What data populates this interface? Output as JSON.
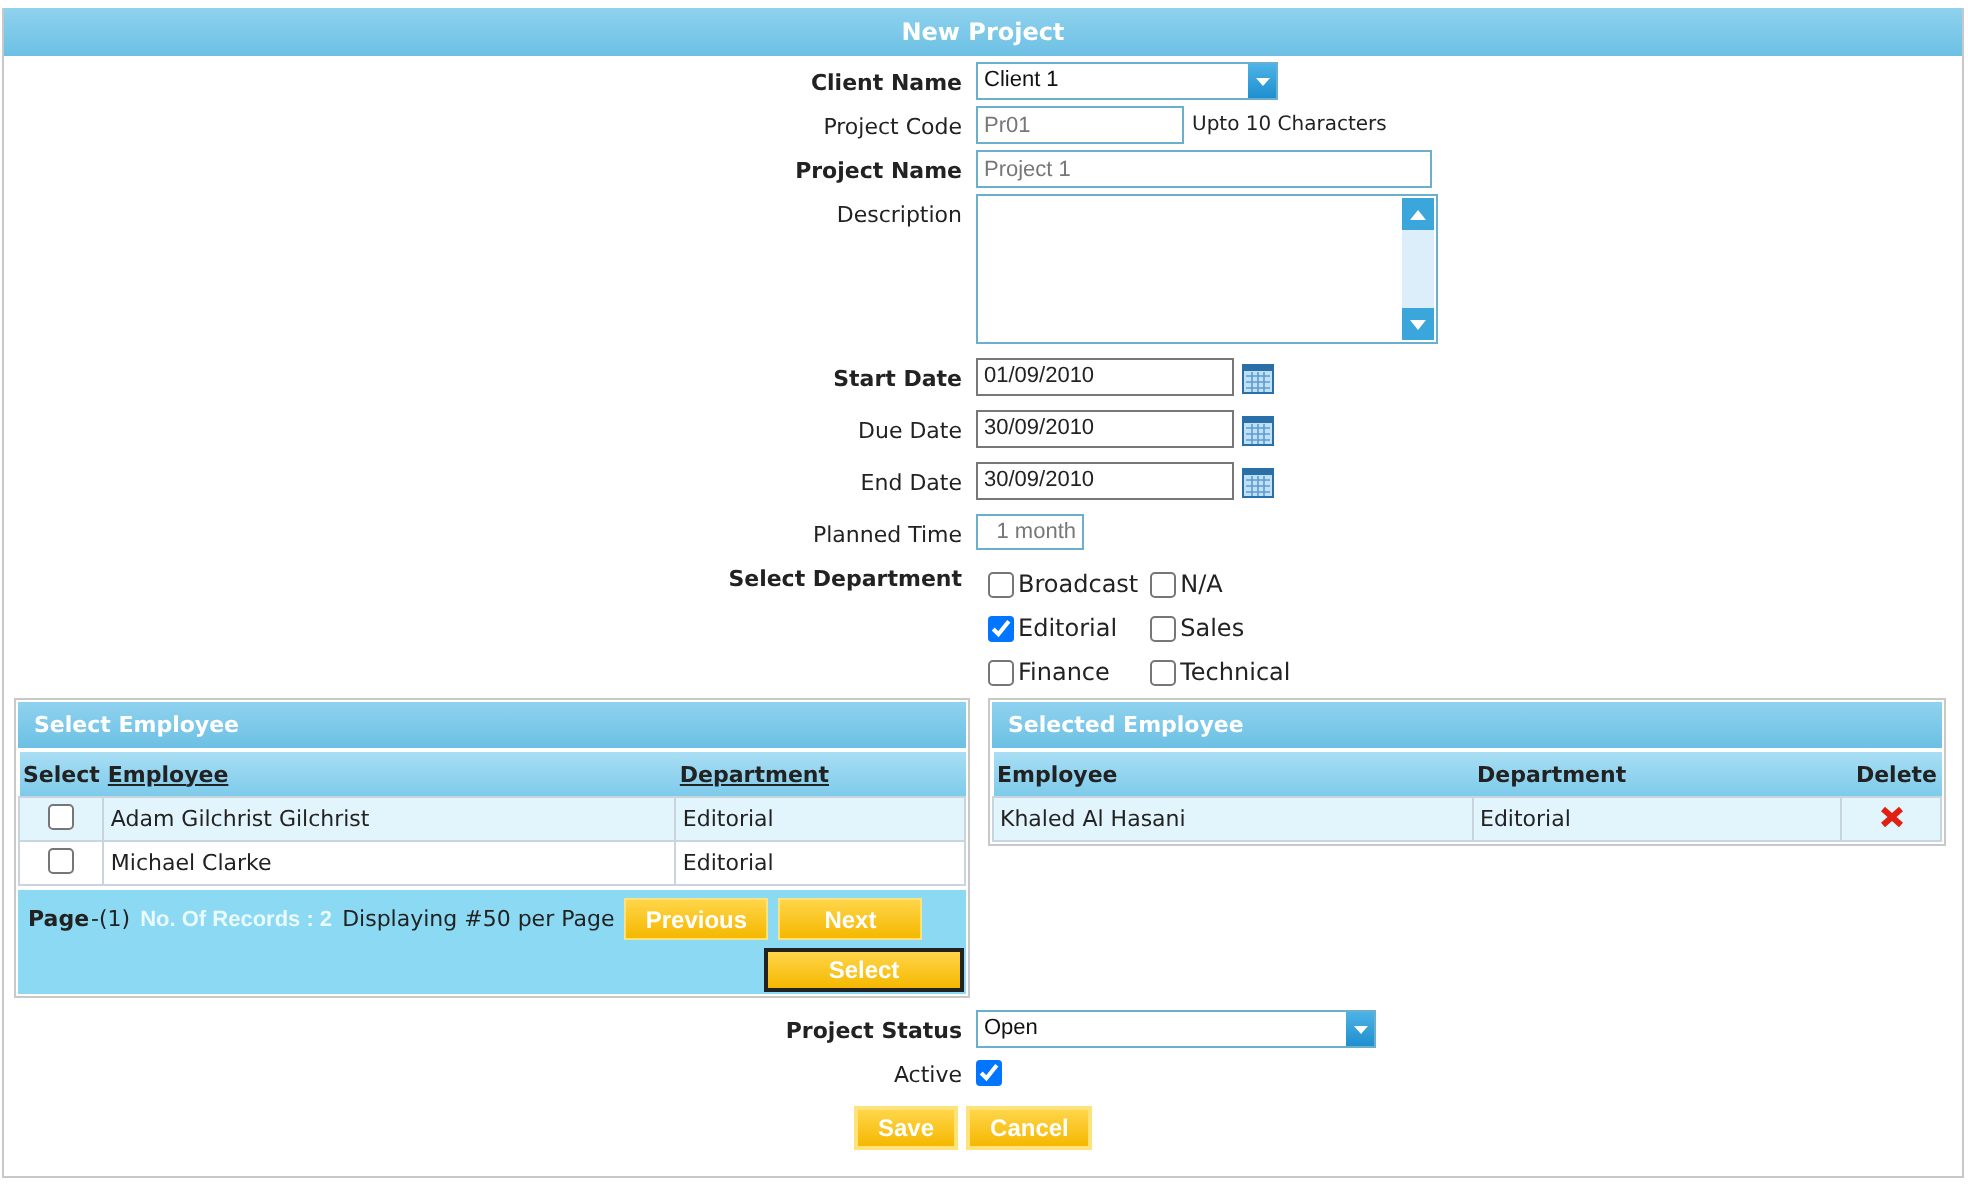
{
  "window": {
    "title": "New Project"
  },
  "fields": [
    {
      "kind": "select",
      "label": "Client Name",
      "required": true,
      "value": "Client 1"
    },
    {
      "kind": "text",
      "label": "Project Code",
      "required": false,
      "placeholder": "Pr01",
      "hint": "Upto 10 Characters"
    },
    {
      "kind": "text",
      "label": "Project Name",
      "required": true,
      "placeholder": "Project 1"
    },
    {
      "kind": "textarea",
      "label": "Description",
      "required": false
    },
    {
      "kind": "date",
      "label": "Start Date",
      "required": true,
      "value": "01/09/2010"
    },
    {
      "kind": "date",
      "label": "Due Date",
      "required": false,
      "value": "30/09/2010"
    },
    {
      "kind": "date",
      "label": "End Date",
      "required": false,
      "value": "30/09/2010"
    },
    {
      "kind": "text",
      "label": "Planned Time",
      "required": false,
      "placeholder": "1 month"
    },
    {
      "kind": "checkgroup",
      "label": "Select Department",
      "required": true,
      "options": [
        {
          "label": "Broadcast",
          "checked": false
        },
        {
          "label": "N/A",
          "checked": false
        },
        {
          "label": "Editorial",
          "checked": true
        },
        {
          "label": "Sales",
          "checked": false
        },
        {
          "label": "Finance",
          "checked": false
        },
        {
          "label": "Technical",
          "checked": false
        }
      ]
    }
  ],
  "select_employee": {
    "title": "Select Employee",
    "columns": [
      "Select",
      "Employee",
      "Department"
    ],
    "rows": [
      {
        "checked": false,
        "employee": "Adam Gilchrist Gilchrist",
        "department": "Editorial"
      },
      {
        "checked": false,
        "employee": "Michael Clarke",
        "department": "Editorial"
      }
    ],
    "pager": {
      "page_label": "Page",
      "page_number": "-(1)",
      "records": "No. Of Records : 2",
      "displaying": "Displaying #50 per Page",
      "previous": "Previous",
      "next": "Next"
    },
    "select_button": "Select"
  },
  "selected_employee": {
    "title": "Selected Employee",
    "columns": [
      "Employee",
      "Department",
      "Delete"
    ],
    "rows": [
      {
        "employee": "Khaled Al Hasani",
        "department": "Editorial"
      }
    ]
  },
  "footer_fields": [
    {
      "kind": "select",
      "label": "Project Status",
      "required": true,
      "value": "Open"
    },
    {
      "kind": "checkbox",
      "label": "Active",
      "required": false,
      "checked": true
    }
  ],
  "buttons": [
    "Save",
    "Cancel"
  ]
}
